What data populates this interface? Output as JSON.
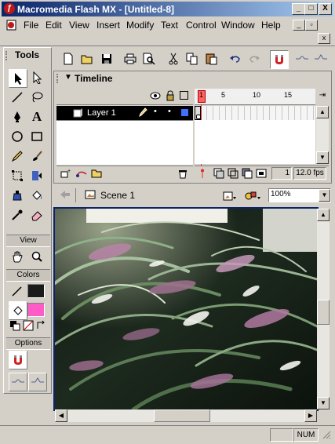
{
  "window": {
    "title": "Macromedia Flash MX - [Untitled-8]",
    "app_icon": "flash-icon"
  },
  "title_buttons": {
    "minimize": "_",
    "maximize": "□",
    "close": "X"
  },
  "menu": [
    "File",
    "Edit",
    "View",
    "Insert",
    "Modify",
    "Text",
    "Control",
    "Window",
    "Help"
  ],
  "mdi_buttons": {
    "minimize": "_",
    "restore": "▫",
    "close": "x"
  },
  "tools": {
    "title": "Tools",
    "view_label": "View",
    "colors_label": "Colors",
    "options_label": "Options",
    "stroke_color": "#1a1a1a",
    "fill_color": "#ff5cc8"
  },
  "timeline": {
    "label": "Timeline",
    "layer_name": "Layer 1",
    "frame_numbers": [
      "1",
      "5",
      "10",
      "15"
    ],
    "current_frame": "1",
    "frame_rate": "12.0 fps"
  },
  "scene": {
    "name": "Scene 1",
    "zoom": "100%"
  },
  "status": {
    "num": "NUM"
  },
  "colors": {
    "titlebar_start": "#0a246a",
    "titlebar_end": "#a6caf0",
    "playhead": "#e03030",
    "layer_selected": "#000000"
  }
}
